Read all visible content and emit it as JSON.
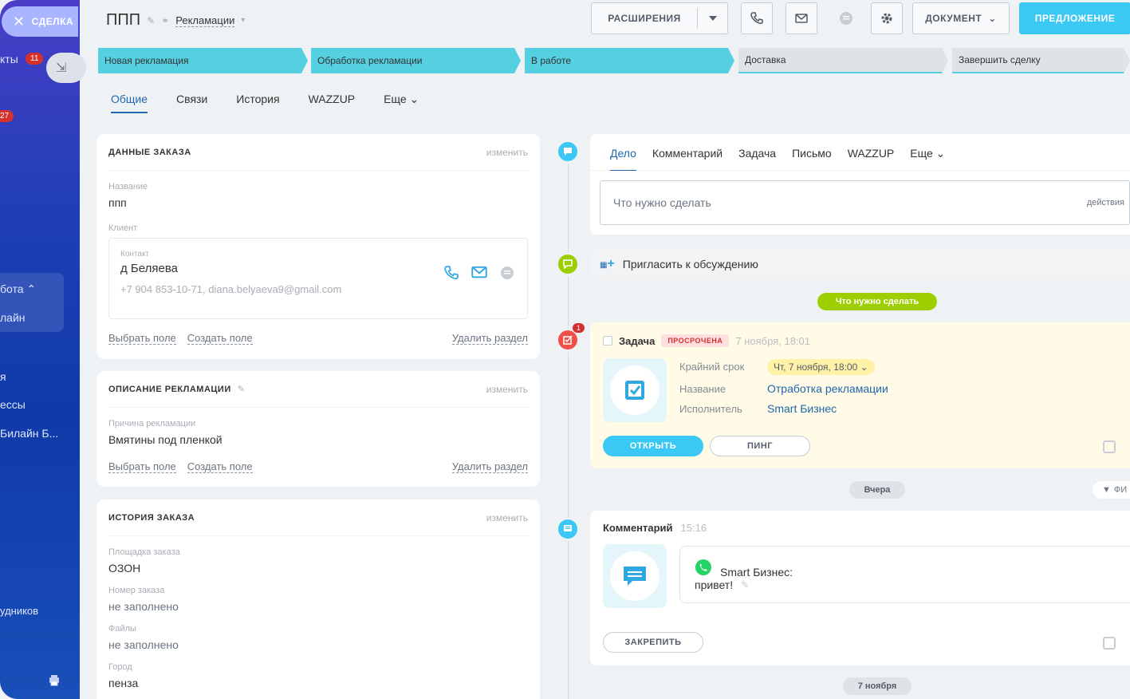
{
  "sidebar": {
    "deal_label": "СДЕЛКА",
    "items": [
      {
        "label": "кты",
        "badge": "11"
      },
      {
        "label": "",
        "badge": "27"
      },
      {
        "label": "бота"
      },
      {
        "label": "лайн"
      },
      {
        "label": "я"
      },
      {
        "label": "ессы"
      },
      {
        "label": "Билайн Б..."
      },
      {
        "label": "удников"
      }
    ]
  },
  "header": {
    "title": "ППП",
    "category": "Рекламации",
    "extensions_label": "РАСШИРЕНИЯ",
    "document_label": "ДОКУМЕНТ",
    "offer_label": "ПРЕДЛОЖЕНИЕ"
  },
  "stages": [
    {
      "label": "Новая рекламация",
      "state": "active"
    },
    {
      "label": "Обработка рекламации",
      "state": "active"
    },
    {
      "label": "В работе",
      "state": "active"
    },
    {
      "label": "Доставка",
      "state": "inactive"
    },
    {
      "label": "Завершить сделку",
      "state": "inactive"
    }
  ],
  "tabs": [
    "Общие",
    "Связи",
    "История",
    "WAZZUP",
    "Еще"
  ],
  "cards": {
    "order": {
      "title": "ДАННЫЕ ЗАКАЗА",
      "edit": "изменить",
      "name_label": "Название",
      "name_value": "ппп",
      "client_label": "Клиент",
      "contact_label": "Контакт",
      "contact_name": "д Беляева",
      "contact_details": "+7 904 853-10-71, diana.belyaeva9@gmail.com",
      "select_field": "Выбрать поле",
      "create_field": "Создать поле",
      "delete_section": "Удалить раздел"
    },
    "description": {
      "title": "ОПИСАНИЕ РЕКЛАМАЦИИ",
      "edit": "изменить",
      "reason_label": "Причина рекламации",
      "reason_value": "Вмятины под пленкой",
      "select_field": "Выбрать поле",
      "create_field": "Создать поле",
      "delete_section": "Удалить раздел"
    },
    "history": {
      "title": "ИСТОРИЯ ЗАКАЗА",
      "edit": "изменить",
      "platform_label": "Площадка заказа",
      "platform_value": "ОЗОН",
      "number_label": "Номер заказа",
      "number_value": "не заполнено",
      "files_label": "Файлы",
      "files_value": "не заполнено",
      "city_label": "Город",
      "city_value": "пенза"
    }
  },
  "activity": {
    "tabs": [
      "Дело",
      "Комментарий",
      "Задача",
      "Письмо",
      "WAZZUP",
      "Еще"
    ],
    "todo_placeholder": "Что нужно сделать",
    "actions_label": "действия",
    "invite_label": "Пригласить к обсуждению",
    "todo_pill": "Что нужно сделать"
  },
  "task": {
    "badge_count": "1",
    "title": "Задача",
    "overdue": "ПРОСРОЧЕНА",
    "date": "7 ноября, 18:01",
    "deadline_label": "Крайний срок",
    "deadline_value": "Чт, 7 ноября, 18:00",
    "name_label": "Название",
    "name_value": "Отработка рекламации",
    "assignee_label": "Исполнитель",
    "assignee_value": "Smart Бизнес",
    "open_label": "ОТКРЫТЬ",
    "ping_label": "ПИНГ"
  },
  "separators": {
    "yesterday": "Вчера",
    "filter": "ФИ",
    "nov7": "7 ноября"
  },
  "comment": {
    "title": "Комментарий",
    "time": "15:16",
    "author": "Smart Бизнес:",
    "text": "привет!",
    "pin_label": "ЗАКРЕПИТЬ"
  },
  "colors": {
    "accent": "#3bc8f5",
    "link": "#2067b0",
    "stage_active": "#55d0e0",
    "green_pill": "#9dcf00",
    "overdue": "#d6302d"
  }
}
